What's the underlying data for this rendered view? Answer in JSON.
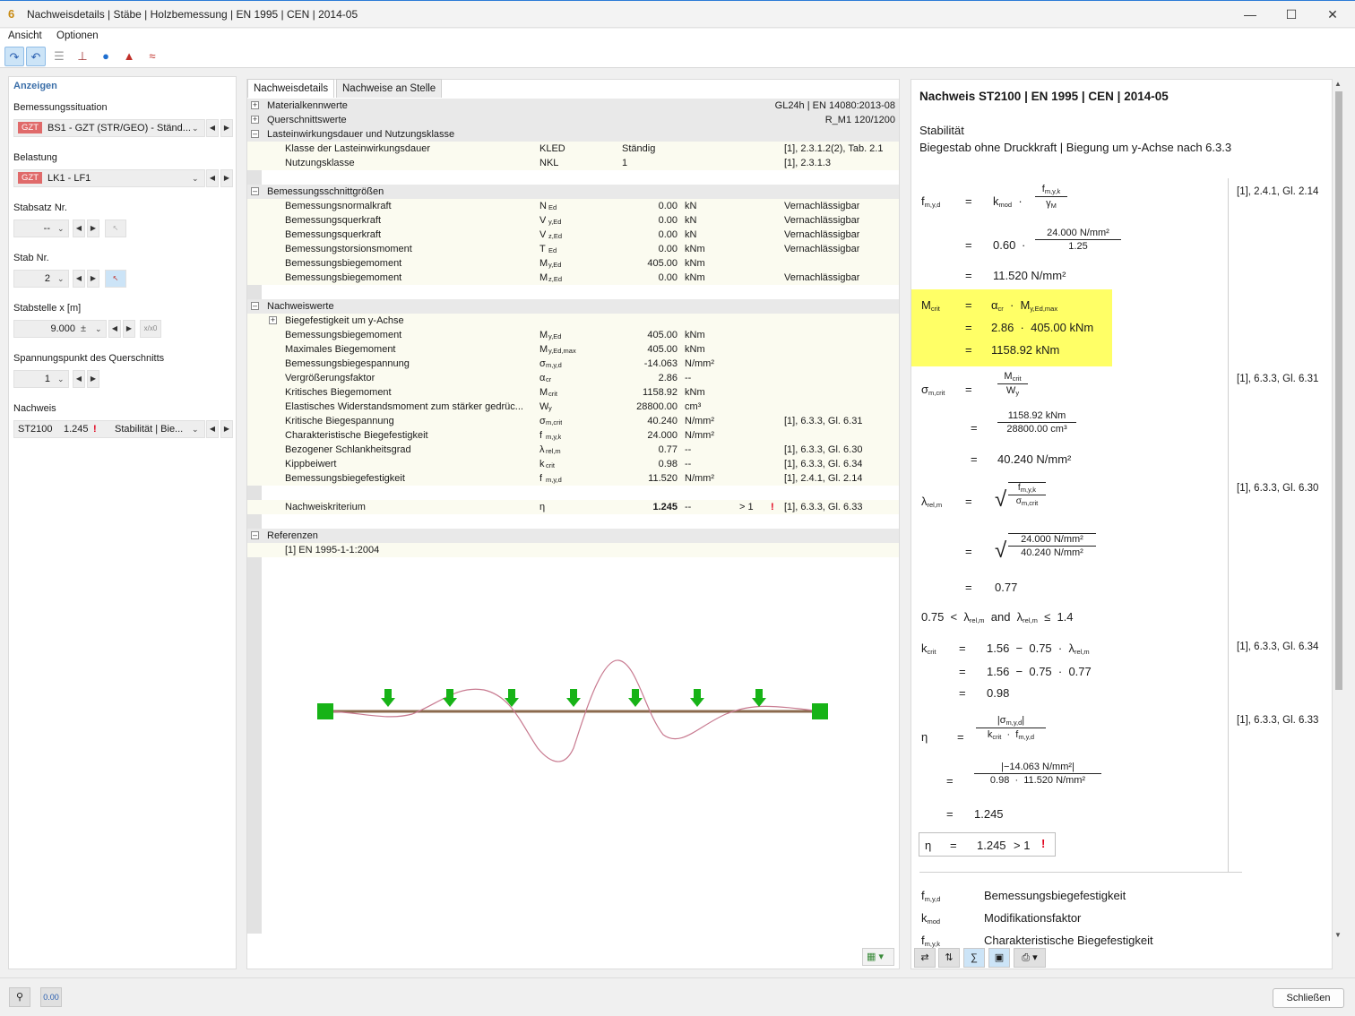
{
  "window": {
    "title": "Nachweisdetails | Stäbe | Holzbemessung | EN 1995 | CEN | 2014-05"
  },
  "menu": [
    "Ansicht",
    "Optionen"
  ],
  "left": {
    "header": "Anzeigen",
    "bemessungssituation": {
      "label": "Bemessungssituation",
      "badge": "GZT",
      "value": "BS1 - GZT (STR/GEO) - Ständ..."
    },
    "belastung": {
      "label": "Belastung",
      "badge": "GZT",
      "value": "LK1 - LF1"
    },
    "stabsatz": {
      "label": "Stabsatz Nr.",
      "value": "--"
    },
    "stab": {
      "label": "Stab Nr.",
      "value": "2"
    },
    "stabstelle": {
      "label": "Stabstelle x [m]",
      "value": "9.000",
      "btn": "x/x0"
    },
    "spannungspunkt": {
      "label": "Spannungspunkt des Querschnitts",
      "value": "1"
    },
    "nachweis": {
      "label": "Nachweis",
      "id": "ST2100",
      "ratio": "1.245",
      "type": "Stabilität | Bie..."
    }
  },
  "tabs": [
    "Nachweisdetails",
    "Nachweise an Stelle"
  ],
  "tree": {
    "mat": {
      "label": "Materialkennwerte",
      "value": "GL24h | EN 14080:2013-08"
    },
    "qs": {
      "label": "Querschnittswerte",
      "value": "R_M1 120/1200"
    },
    "ld": {
      "label": "Lasteinwirkungsdauer und Nutzungsklasse"
    },
    "ld_rows": [
      {
        "name": "Klasse der Lasteinwirkungsdauer",
        "sym": "KLED",
        "val": "Ständig",
        "ref": "[1], 2.3.1.2(2), Tab. 2.1"
      },
      {
        "name": "Nutzungsklasse",
        "sym": "NKL",
        "val": "1",
        "ref": "[1], 2.3.1.3"
      }
    ],
    "bs": {
      "label": "Bemessungsschnittgrößen"
    },
    "bs_rows": [
      {
        "name": "Bemessungsnormalkraft",
        "sym": "N",
        "sub": "Ed",
        "val": "0.00",
        "unit": "kN",
        "ref": "Vernachlässigbar"
      },
      {
        "name": "Bemessungsquerkraft",
        "sym": "V",
        "sub": "y,Ed",
        "val": "0.00",
        "unit": "kN",
        "ref": "Vernachlässigbar"
      },
      {
        "name": "Bemessungsquerkraft",
        "sym": "V",
        "sub": "z,Ed",
        "val": "0.00",
        "unit": "kN",
        "ref": "Vernachlässigbar"
      },
      {
        "name": "Bemessungstorsionsmoment",
        "sym": "T",
        "sub": "Ed",
        "val": "0.00",
        "unit": "kNm",
        "ref": "Vernachlässigbar"
      },
      {
        "name": "Bemessungsbiegemoment",
        "sym": "M",
        "sub": "y,Ed",
        "val": "405.00",
        "unit": "kNm",
        "ref": ""
      },
      {
        "name": "Bemessungsbiegemoment",
        "sym": "M",
        "sub": "z,Ed",
        "val": "0.00",
        "unit": "kNm",
        "ref": "Vernachlässigbar"
      }
    ],
    "nw": {
      "label": "Nachweiswerte"
    },
    "nw_sub": "Biegefestigkeit um y-Achse",
    "nw_rows": [
      {
        "name": "Bemessungsbiegemoment",
        "sym": "M",
        "sub": "y,Ed",
        "val": "405.00",
        "unit": "kNm",
        "ref": ""
      },
      {
        "name": "Maximales Biegemoment",
        "sym": "M",
        "sub": "y,Ed,max",
        "val": "405.00",
        "unit": "kNm",
        "ref": ""
      },
      {
        "name": "Bemessungsbiegespannung",
        "sym": "σ",
        "sub": "m,y,d",
        "val": "-14.063",
        "unit": "N/mm²",
        "ref": ""
      },
      {
        "name": "Vergrößerungsfaktor",
        "sym": "α",
        "sub": "cr",
        "val": "2.86",
        "unit": "--",
        "ref": ""
      },
      {
        "name": "Kritisches Biegemoment",
        "sym": "M",
        "sub": "crit",
        "val": "1158.92",
        "unit": "kNm",
        "ref": ""
      },
      {
        "name": "Elastisches Widerstandsmoment zum stärker gedrüc...",
        "sym": "W",
        "sub": "y",
        "val": "28800.00",
        "unit": "cm³",
        "ref": ""
      },
      {
        "name": "Kritische Biegespannung",
        "sym": "σ",
        "sub": "m,crit",
        "val": "40.240",
        "unit": "N/mm²",
        "ref": "[1], 6.3.3, Gl. 6.31"
      },
      {
        "name": "Charakteristische Biegefestigkeit",
        "sym": "f",
        "sub": "m,y,k",
        "val": "24.000",
        "unit": "N/mm²",
        "ref": ""
      },
      {
        "name": "Bezogener Schlankheitsgrad",
        "sym": "λ",
        "sub": "rel,m",
        "val": "0.77",
        "unit": "--",
        "ref": "[1], 6.3.3, Gl. 6.30"
      },
      {
        "name": "Kippbeiwert",
        "sym": "k",
        "sub": "crit",
        "val": "0.98",
        "unit": "--",
        "ref": "[1], 6.3.3, Gl. 6.34"
      },
      {
        "name": "Bemessungsbiegefestigkeit",
        "sym": "f",
        "sub": "m,y,d",
        "val": "11.520",
        "unit": "N/mm²",
        "ref": "[1], 2.4.1, Gl. 2.14"
      }
    ],
    "crit": {
      "name": "Nachweiskriterium",
      "sym": "η",
      "val": "1.245",
      "unit": "--",
      "cmp": "> 1",
      "ref": "[1], 6.3.3, Gl. 6.33"
    },
    "refs": {
      "label": "Referenzen",
      "item": "[1]  EN 1995-1-1:2004"
    }
  },
  "right": {
    "title": "Nachweis ST2100 | EN 1995 | CEN | 2014-05",
    "line1": "Stabilität",
    "line2": "Biegestab ohne Druckkraft | Biegung um y-Achse nach 6.3.3",
    "refs": [
      "[1], 2.4.1, Gl. 2.14",
      "[1], 6.3.3, Gl. 6.31",
      "[1], 6.3.3, Gl. 6.30",
      "[1], 6.3.3, Gl. 6.34",
      "[1], 6.3.3, Gl. 6.33"
    ],
    "fmyd": {
      "kmod": "0.60",
      "fmyk": "24.000 N/mm²",
      "gammaM": "1.25",
      "result": "11.520 N/mm²"
    },
    "mcrit": {
      "alpha": "2.86",
      "myed": "405.00 kNm",
      "result": "1158.92 kNm"
    },
    "sigma": {
      "mcrit": "1158.92 kNm",
      "wy": "28800.00 cm³",
      "result": "40.240 N/mm²"
    },
    "lambda": {
      "num": "24.000 N/mm²",
      "den": "40.240 N/mm²",
      "result": "0.77",
      "lo": "0.75",
      "hi": "1.4"
    },
    "kcrit": {
      "a": "1.56",
      "b": "0.75",
      "lam": "0.77",
      "result": "0.98"
    },
    "eta": {
      "num": "−14.063 N/mm²",
      "kcrit": "0.98",
      "fmyd": "11.520 N/mm²",
      "result": "1.245",
      "final": "1.245"
    },
    "legend": [
      {
        "sym": "f",
        "sub": "m,y,d",
        "text": "Bemessungsbiegefestigkeit"
      },
      {
        "sym": "k",
        "sub": "mod",
        "text": "Modifikationsfaktor"
      },
      {
        "sym": "f",
        "sub": "m,y,k",
        "text": "Charakteristische Biegefestigkeit"
      }
    ]
  },
  "footer": {
    "close": "Schließen"
  },
  "colors": {
    "highlight": "#ffff66",
    "accent": "#2b7bd6",
    "beam": "#8b6a4e",
    "support": "#17b317"
  }
}
